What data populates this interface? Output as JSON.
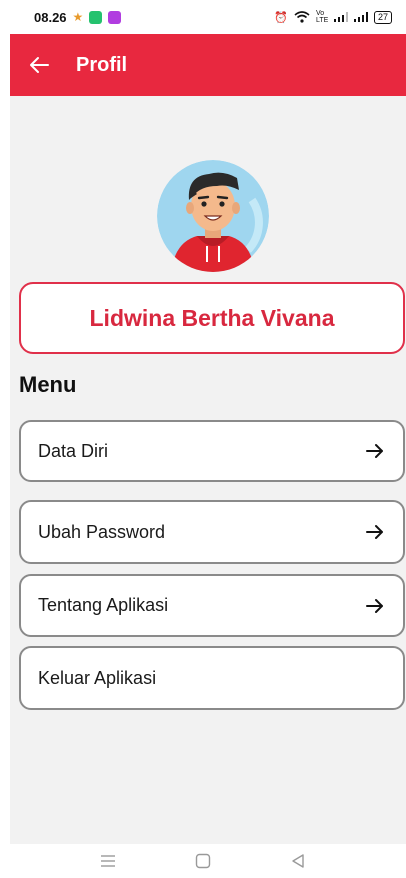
{
  "status_bar": {
    "time": "08.26",
    "network_label": "Vo LTE",
    "battery": "27"
  },
  "app_bar": {
    "title": "Profil",
    "back_icon": "arrow-left-icon"
  },
  "profile": {
    "avatar_icon": "user-avatar",
    "name": "Lidwina Bertha Vivana"
  },
  "menu": {
    "heading": "Menu",
    "items": [
      {
        "label": "Data Diri",
        "icon": "arrow-right-icon"
      },
      {
        "label": "Ubah Password",
        "icon": "arrow-right-icon"
      },
      {
        "label": "Tentang Aplikasi",
        "icon": "arrow-right-icon"
      },
      {
        "label": "Keluar Aplikasi"
      }
    ]
  },
  "nav_bar": {
    "icons": [
      "menu-icon",
      "home-icon",
      "back-triangle-icon"
    ]
  },
  "colors": {
    "primary": "#e8283f",
    "name_text": "#d8283f",
    "background": "#f2f2f2"
  }
}
